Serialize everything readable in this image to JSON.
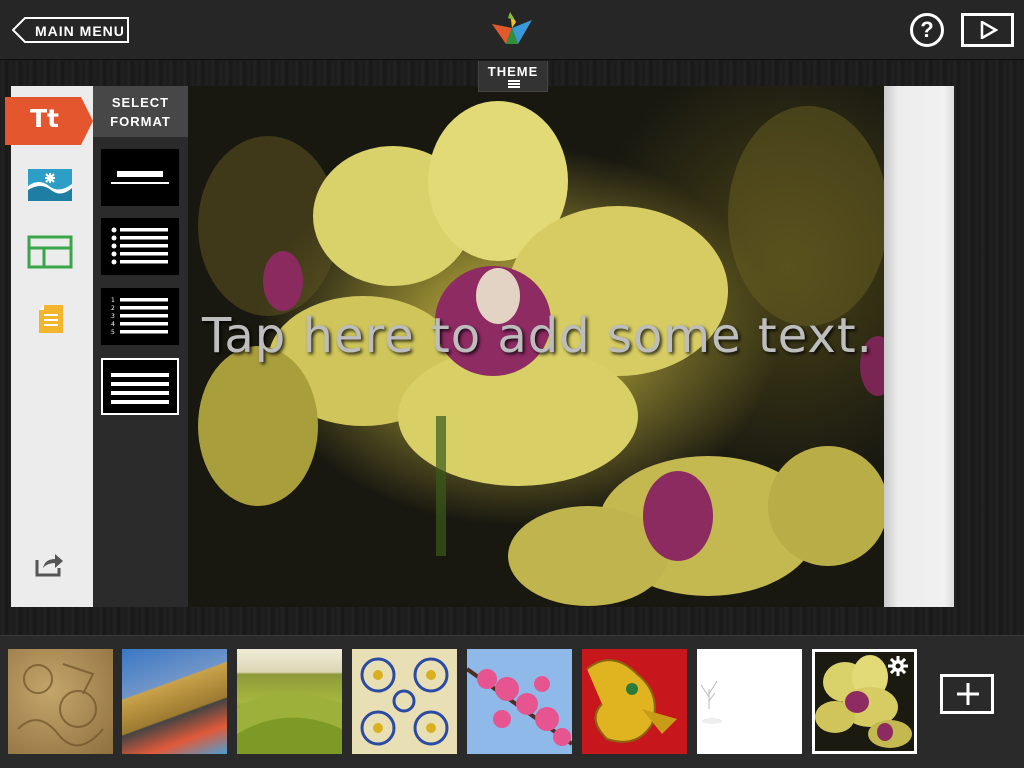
{
  "topbar": {
    "main_menu_label": "MAIN MENU",
    "help_label": "?"
  },
  "theme_tab": {
    "label": "THEME"
  },
  "tools": {
    "text_label": "Tt"
  },
  "format_panel": {
    "title": "SELECT FORMAT",
    "options": [
      "title",
      "bulleted-list",
      "numbered-list",
      "paragraph"
    ],
    "selected": "paragraph"
  },
  "canvas": {
    "placeholder": "Tap here to add some text."
  },
  "filmstrip": {
    "thumbnails": [
      "carved-stone",
      "building-facade",
      "green-hills",
      "blue-tiles",
      "pink-blossoms",
      "golden-dragon",
      "white-tree",
      "yellow-orchid"
    ],
    "active": "yellow-orchid"
  },
  "colors": {
    "accent": "#e4572e",
    "topbar": "#262626",
    "panel": "#2b2b2b"
  }
}
